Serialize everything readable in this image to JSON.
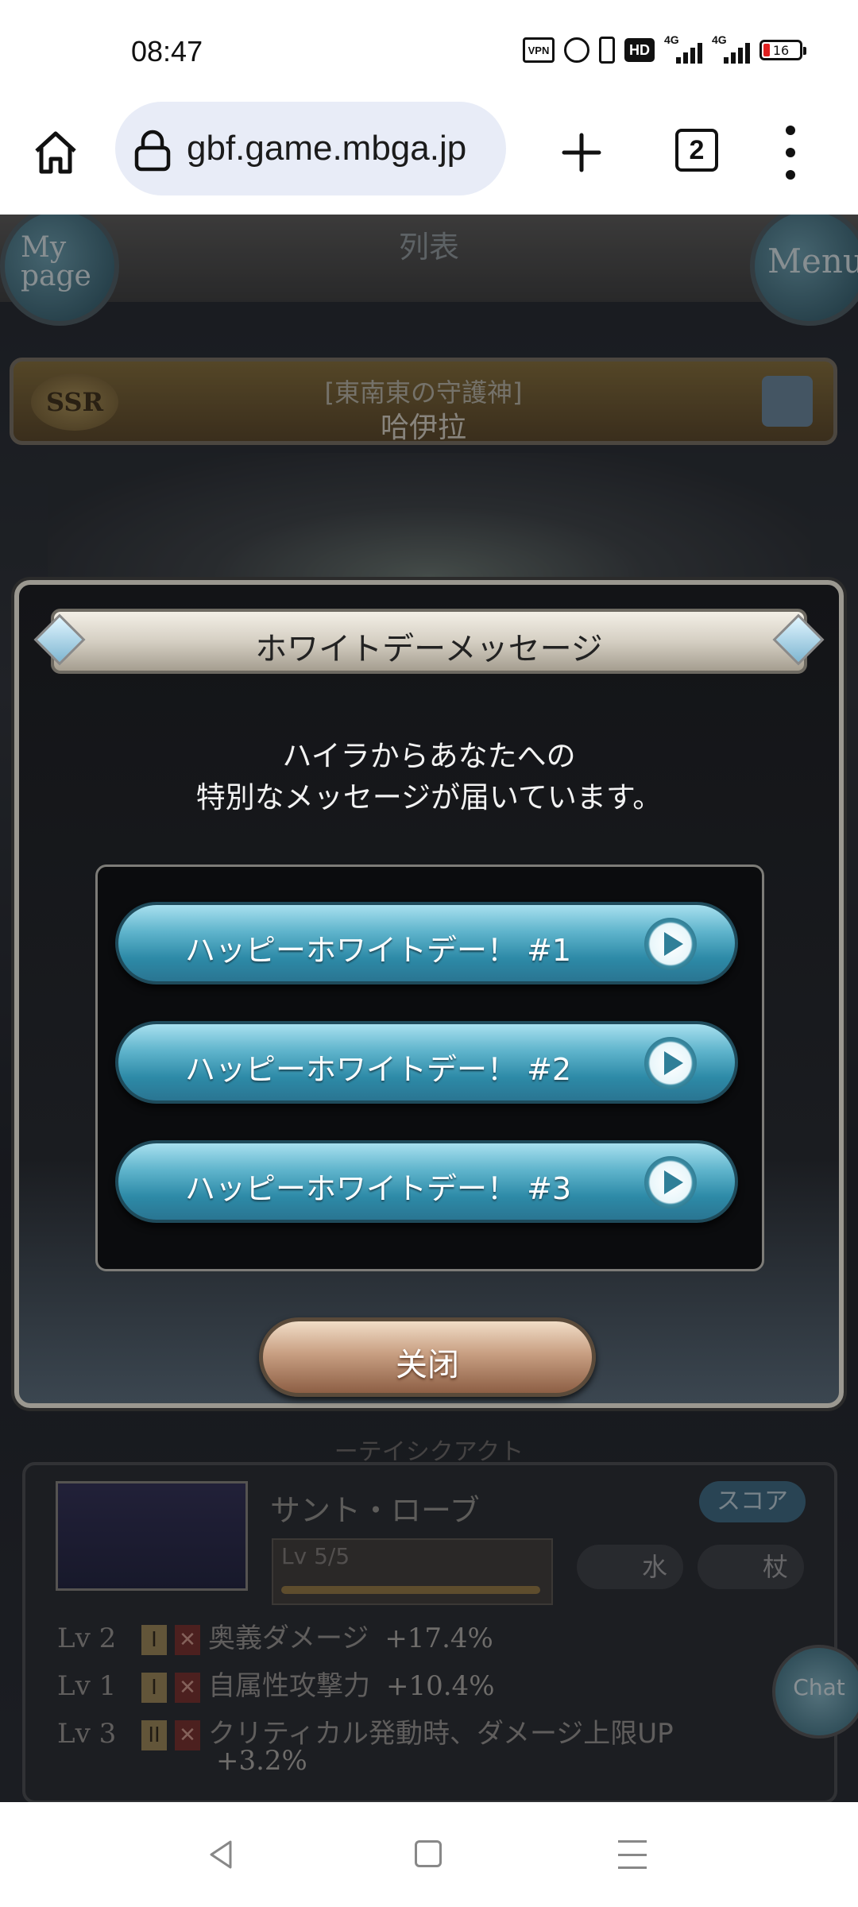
{
  "status_bar": {
    "time": "08:47",
    "hd_label": "HD",
    "signal_labels": [
      "4G",
      "4G"
    ],
    "battery": "16"
  },
  "browser": {
    "url": "gbf.game.mbga.jp",
    "tab_count": "2"
  },
  "game": {
    "topbar_title": "列表",
    "mypage_label": "My page",
    "menu_label": "Menu",
    "character": {
      "rarity": "SSR",
      "subtitle": "[東南東の守護神]",
      "name": "哈伊拉"
    },
    "modal": {
      "title": "ホワイトデーメッセージ",
      "message_line1": "ハイラからあなたへの",
      "message_line2": "特別なメッセージが届いています。",
      "buttons": [
        {
          "label": "ハッピーホワイトデー！ #1"
        },
        {
          "label": "ハッピーホワイトデー！ #2"
        },
        {
          "label": "ハッピーホワイトデー！ #3"
        }
      ],
      "close_label": "关闭"
    },
    "weapon": {
      "section_label": "ーテイシクアクト",
      "name": "サント・ローブ",
      "score_label": "スコア",
      "level": "Lv 5/5",
      "element": "水",
      "weapon_type": "杖",
      "skills": [
        {
          "lv": "Lv 2",
          "rank": "I",
          "name": "奥義ダメージ",
          "value": "+17.4%"
        },
        {
          "lv": "Lv 1",
          "rank": "I",
          "name": "自属性攻撃力",
          "value": "+10.4%"
        },
        {
          "lv": "Lv 3",
          "rank": "II",
          "name": "クリティカル発動時、ダメージ上限UP",
          "value": "+3.2%"
        }
      ]
    },
    "chat_label": "Chat"
  }
}
